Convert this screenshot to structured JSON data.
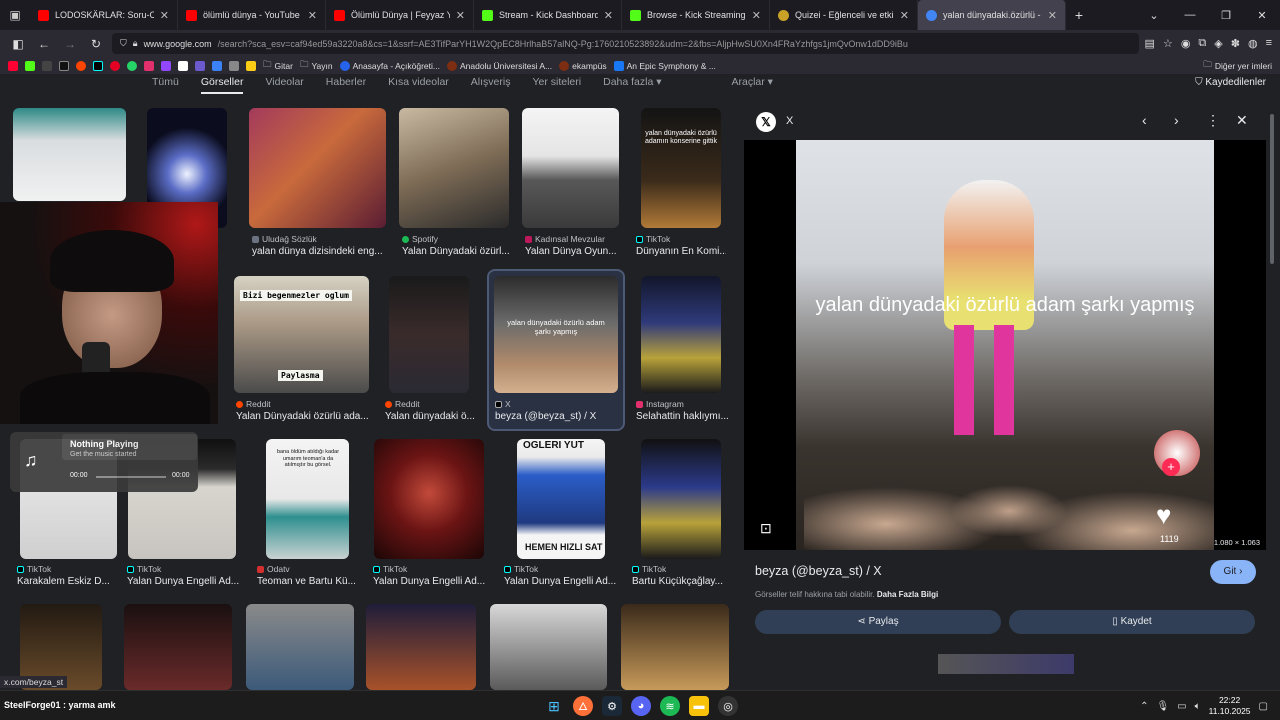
{
  "tabs": [
    {
      "title": "LODOSKÄRLAR: Soru-Cevap ve",
      "icon": "youtube-icon",
      "color": "#ff0000"
    },
    {
      "title": "ölümlü dünya - YouTube",
      "icon": "youtube-icon",
      "color": "#ff0000"
    },
    {
      "title": "Ölümlü Dünya | Feyyaz Yiğit FU",
      "icon": "youtube-icon",
      "color": "#ff0000"
    },
    {
      "title": "Stream - Kick Dashboard",
      "icon": "kick-icon",
      "color": "#53fc18"
    },
    {
      "title": "Browse - Kick Streaming",
      "icon": "kick-icon",
      "color": "#53fc18"
    },
    {
      "title": "Quizei - Eğlenceli ve etkileşimli",
      "icon": "quizei-icon",
      "color": "#c9a227"
    },
    {
      "title": "yalan dünyadaki.özürlü - Googl",
      "icon": "google-icon",
      "color": "#4285f4"
    }
  ],
  "url": {
    "main": "www.google.com",
    "rest": "/search?sca_esv=caf94ed59a3220a8&cs=1&ssrf=AE3TifParYH1W2QpEC8HrlhaB57alNQ-Pg:1760210523892&udm=2&fbs=AljpHwSU0Xn4FRaYzhfgs1jmQvOnw1dDD9iBu"
  },
  "bookmarks": {
    "items": [
      "Gitar",
      "Yayın",
      "Anasayfa - Açıköğreti...",
      "Anadolu Üniversitesi A...",
      "ekampüs",
      "An Epic Symphony & ..."
    ],
    "other": "Diğer yer imleri"
  },
  "search_tabs": [
    "Tümü",
    "Görseller",
    "Videolar",
    "Haberler",
    "Kısa videolar",
    "Alışveriş",
    "Yer siteleri",
    "Daha fazla ▾",
    "Araçlar ▾"
  ],
  "saved_label": "Kaydedilenler",
  "results": [
    {
      "source": "Uludağ Sözlük",
      "title": "yalan dünya dizisindeki eng..."
    },
    {
      "source": "Spotify",
      "title": "Yalan Dünyadaki özürl..."
    },
    {
      "source": "Kadınsal Mevzular",
      "title": "Yalan Dünya Oyun..."
    },
    {
      "source": "TikTok",
      "title": "Dünyanın En Komi..."
    },
    {
      "source": "Reddit",
      "title": "Yalan Dünyadaki özürlü ada..."
    },
    {
      "source": "Reddit",
      "title": "Yalan dünyadaki ö..."
    },
    {
      "source": "X",
      "title": "beyza (@beyza_st) / X"
    },
    {
      "source": "Instagram",
      "title": "Selahattin haklıymı..."
    },
    {
      "source": "TikTok",
      "title": "Karakalem Eskiz D..."
    },
    {
      "source": "TikTok",
      "title": "Yalan Dunya Engelli Ad..."
    },
    {
      "source": "Odatv",
      "title": "Teoman ve Bartu Kü..."
    },
    {
      "source": "TikTok",
      "title": "Yalan Dunya Engelli Ad..."
    },
    {
      "source": "TikTok",
      "title": "Yalan Dunya Engelli Ad..."
    },
    {
      "source": "TikTok",
      "title": "Bartu Küçükçağlay..."
    }
  ],
  "thumb_text": {
    "t1": "Bizi begenmezler oglum",
    "t2": "Paylasma",
    "t3": "yalan dünyadaki özürlü adam şarkı yapmış",
    "t4": "HEMEN HIZLI SAT",
    "t5": "OGLERI YUT",
    "t6": "yalan dünyadaki özürlü adamın konserine gittik",
    "t7": "bana öldüm atıldığı kadar umarım teoman'a da atılmıştır bu görsel."
  },
  "music": {
    "title": "Nothing Playing",
    "subtitle": "Get the music started",
    "time_start": "00:00",
    "time_end": "00:00"
  },
  "panel": {
    "site": "X",
    "image_caption": "yalan dünyadaki özürlü adam şarkı yapmış",
    "dimensions": "1.080 × 1.063",
    "likes": "1119",
    "title": "beyza (@beyza_st) / X",
    "visit": "Git",
    "copyright": "Görseller telif hakkına tabi olabilir.",
    "more_info": "Daha Fazla Bilgi",
    "share": "Paylaş",
    "save": "Kaydet"
  },
  "status_url": "x.com/beyza_st",
  "taskbar": {
    "user": "SteelForge01 : yarma amk",
    "time": "22:22",
    "date": "11.10.2025"
  }
}
